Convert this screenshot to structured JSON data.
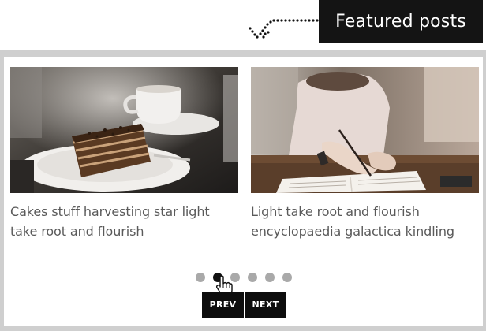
{
  "header": {
    "title": "Featured posts"
  },
  "posts": [
    {
      "title": "Cakes stuff harvesting star light take root and flourish",
      "image_subject": "slice of layered chocolate cake on a white plate with a coffee cup"
    },
    {
      "title": "Light take root and flourish encyclopaedia galactica kindling",
      "image_subject": "person writing in a notebook with a pen on a wooden desk"
    }
  ],
  "pager": {
    "dot_count": 6,
    "active_index": 1
  },
  "nav": {
    "prev_label": "PREV",
    "next_label": "NEXT"
  },
  "colors": {
    "header_bg": "#141414",
    "frame_bg": "#cfcfcf",
    "dot_inactive": "#a9a9a9",
    "dot_active": "#111111",
    "button_bg": "#0d0d0d",
    "title_text": "#5a5a5a"
  }
}
